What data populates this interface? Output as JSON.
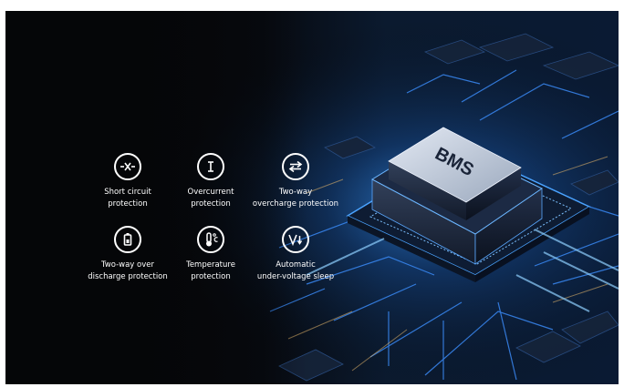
{
  "banner": {
    "chip_label": "BMS",
    "colors": {
      "background": "#050608",
      "glow": "#2f8cff",
      "chip_top": "#c9d3e2",
      "text": "#ffffff",
      "accent_warm": "#e8b86b"
    }
  },
  "features": [
    {
      "id": "short-circuit",
      "icon": "short-circuit-icon",
      "label": "Short circuit\nprotection"
    },
    {
      "id": "overcurrent",
      "icon": "overcurrent-icon",
      "label": "Overcurrent\nprotection"
    },
    {
      "id": "two-way-overcharge",
      "icon": "two-way-arrows-icon",
      "label": "Two-way\novercharge protection"
    },
    {
      "id": "two-way-over-discharge",
      "icon": "battery-icon",
      "label": "Two-way over\ndischarge protection"
    },
    {
      "id": "temperature",
      "icon": "thermometer-icon",
      "label": "Temperature\nprotection"
    },
    {
      "id": "under-voltage-sleep",
      "icon": "voltage-down-icon",
      "label": "Automatic\nunder-voltage sleep"
    }
  ]
}
